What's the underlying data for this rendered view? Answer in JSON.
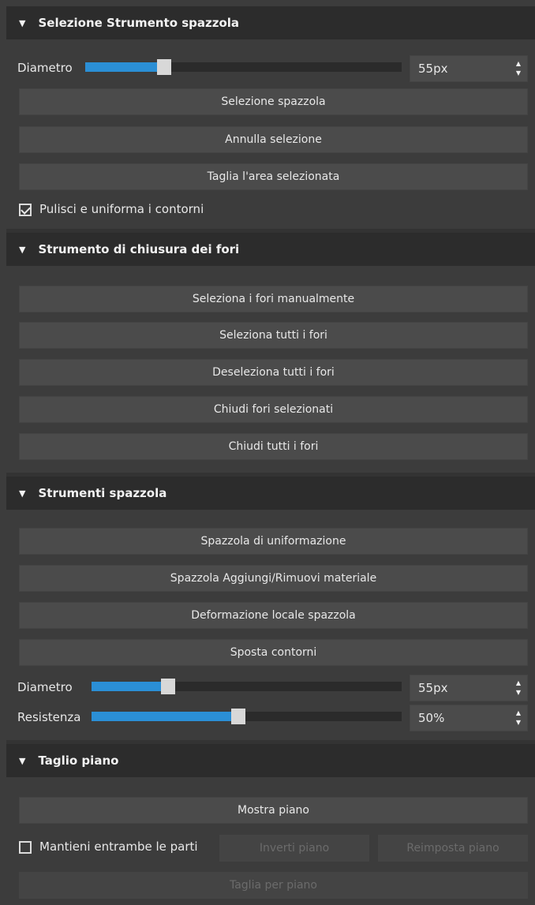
{
  "section1": {
    "title": "Selezione Strumento spazzola",
    "diameter": {
      "label": "Diametro",
      "value": "55px",
      "fraction": 0.25
    },
    "buttons": [
      "Selezione spazzola",
      "Annulla selezione",
      "Taglia l'area selezionata"
    ],
    "checkbox": {
      "label": "Pulisci e uniforma i contorni",
      "checked": true
    }
  },
  "section2": {
    "title": "Strumento di chiusura dei fori",
    "buttons": [
      "Seleziona i fori manualmente",
      "Seleziona tutti i fori",
      "Deseleziona tutti i fori",
      "Chiudi fori selezionati",
      "Chiudi tutti i fori"
    ]
  },
  "section3": {
    "title": "Strumenti spazzola",
    "buttons": [
      "Spazzola di uniformazione",
      "Spazzola Aggiungi/Rimuovi materiale",
      "Deformazione locale spazzola",
      "Sposta contorni"
    ],
    "diameter": {
      "label": "Diametro",
      "value": "55px",
      "fraction": 0.25
    },
    "strength": {
      "label": "Resistenza",
      "value": "50%",
      "fraction": 0.5
    }
  },
  "section4": {
    "title": "Taglio piano",
    "show_plane": "Mostra piano",
    "keep_both": {
      "label": "Mantieni entrambe le parti",
      "checked": false
    },
    "invert_plane": "Inverti piano",
    "reset_plane": "Reimposta piano",
    "cut_by_plane": "Taglia per piano"
  },
  "colors": {
    "accent": "#2b8fd6",
    "header_bg": "#2c2c2c",
    "panel_bg": "#3c3c3c",
    "button_bg": "#4b4b4b"
  }
}
